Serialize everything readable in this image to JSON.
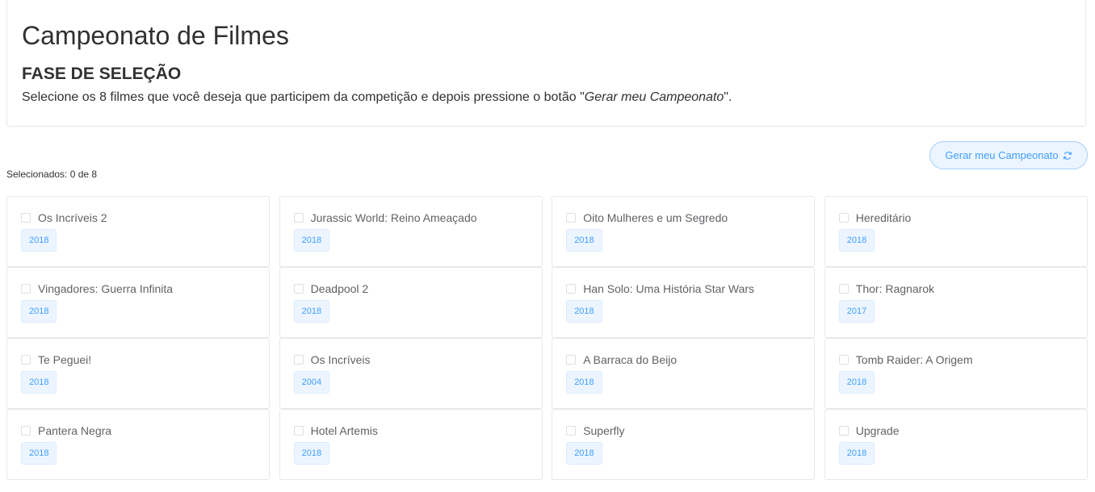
{
  "header": {
    "title": "Campeonato de Filmes",
    "phase": "FASE DE SELEÇÃO",
    "instructions_prefix": "Selecione os 8 filmes que você deseja que participem da competição e depois pressione o botão \"",
    "instructions_emph": "Gerar meu Campeonato",
    "instructions_suffix": "\"."
  },
  "selection": {
    "label": "Selecionados: 0 de 8"
  },
  "toolbar": {
    "generate_label": "Gerar meu Campeonato",
    "generate_icon": "refresh-icon"
  },
  "colors": {
    "accent": "#409eff",
    "accent_bg": "#ecf5ff",
    "border": "#e8e8e8"
  },
  "films": [
    {
      "title": "Os Incríveis 2",
      "year": "2018",
      "checked": false
    },
    {
      "title": "Jurassic World: Reino Ameaçado",
      "year": "2018",
      "checked": false
    },
    {
      "title": "Oito Mulheres e um Segredo",
      "year": "2018",
      "checked": false
    },
    {
      "title": "Hereditário",
      "year": "2018",
      "checked": false
    },
    {
      "title": "Vingadores: Guerra Infinita",
      "year": "2018",
      "checked": false
    },
    {
      "title": "Deadpool 2",
      "year": "2018",
      "checked": false
    },
    {
      "title": "Han Solo: Uma História Star Wars",
      "year": "2018",
      "checked": false
    },
    {
      "title": "Thor: Ragnarok",
      "year": "2017",
      "checked": false
    },
    {
      "title": "Te Peguei!",
      "year": "2018",
      "checked": false
    },
    {
      "title": "Os Incríveis",
      "year": "2004",
      "checked": false
    },
    {
      "title": "A Barraca do Beijo",
      "year": "2018",
      "checked": false
    },
    {
      "title": "Tomb Raider: A Origem",
      "year": "2018",
      "checked": false
    },
    {
      "title": "Pantera Negra",
      "year": "2018",
      "checked": false
    },
    {
      "title": "Hotel Artemis",
      "year": "2018",
      "checked": false
    },
    {
      "title": "Superfly",
      "year": "2018",
      "checked": false
    },
    {
      "title": "Upgrade",
      "year": "2018",
      "checked": false
    }
  ]
}
